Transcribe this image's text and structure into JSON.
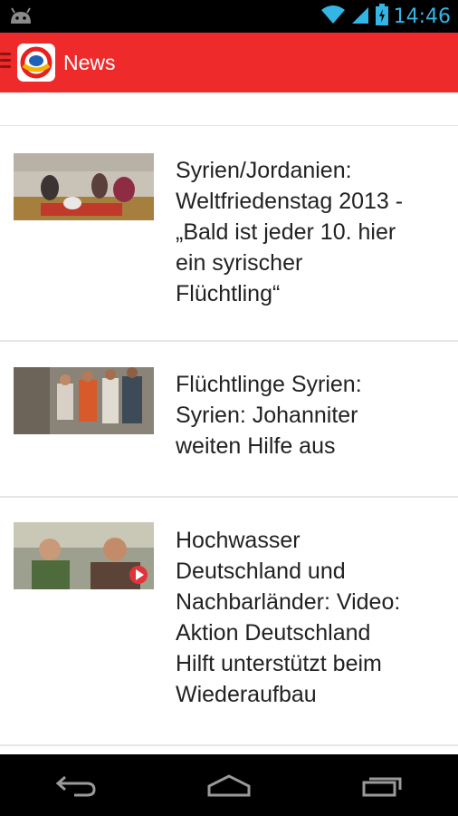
{
  "status_bar": {
    "time": "14:46",
    "icons": [
      "android-icon",
      "wifi-icon",
      "signal-icon",
      "battery-icon"
    ]
  },
  "action_bar": {
    "title": "News",
    "logo_icon": "app-logo-icon",
    "color": "#ee2a2a"
  },
  "news": [
    {
      "title": "Syrien/Jordanien:\nWeltfriedenstag 2013 -\n„Bald ist jeder 10. hier\nein syrischer\nFlüchtling“",
      "thumb": "refugee-tent-photo"
    },
    {
      "title": "Flüchtlinge Syrien:\nSyrien: Johanniter\nweiten Hilfe aus",
      "thumb": "children-photo"
    },
    {
      "title": "Hochwasser\nDeutschland und\nNachbarländer: Video:\nAktion Deutschland\nHilft unterstützt beim\nWiederaufbau",
      "thumb": "video-two-men-photo"
    }
  ],
  "nav_bar": {
    "icons": [
      "back-icon",
      "home-icon",
      "recent-apps-icon"
    ]
  }
}
